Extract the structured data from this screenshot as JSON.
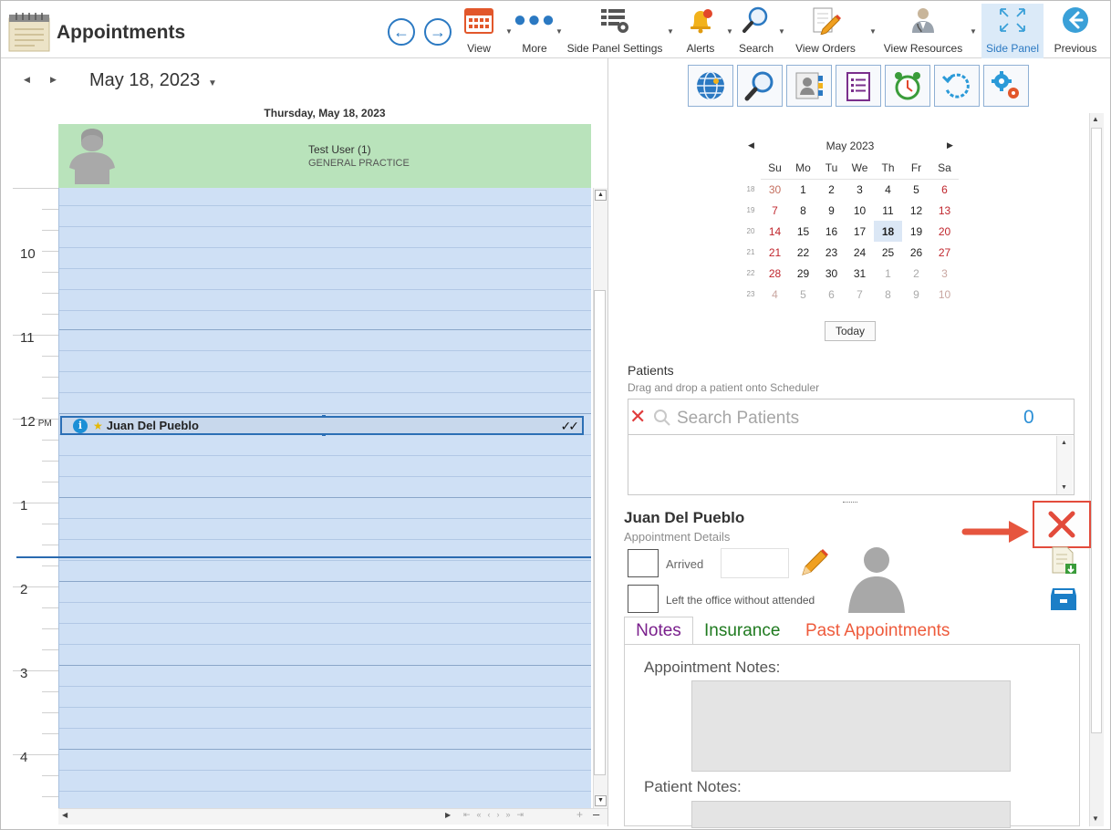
{
  "app": {
    "title": "Appointments"
  },
  "toolbar": {
    "view_label": "View",
    "more_label": "More",
    "side_panel_settings_label": "Side Panel Settings",
    "alerts_label": "Alerts",
    "search_label": "Search",
    "view_orders_label": "View Orders",
    "view_resources_label": "View Resources",
    "side_panel_label": "Side Panel",
    "previous_label": "Previous"
  },
  "scheduler": {
    "date_label": "May 18, 2023",
    "day_header": "Thursday, May 18, 2023",
    "resource_name": "Test User (1)",
    "resource_dept": "GENERAL PRACTICE",
    "hours": [
      {
        "label": "10",
        "suffix": ""
      },
      {
        "label": "11",
        "suffix": ""
      },
      {
        "label": "12",
        "suffix": "PM"
      },
      {
        "label": "1",
        "suffix": ""
      },
      {
        "label": "2",
        "suffix": ""
      },
      {
        "label": "3",
        "suffix": ""
      },
      {
        "label": "4",
        "suffix": ""
      }
    ],
    "appointment": {
      "patient": "Juan Del Pueblo",
      "status_marks": "✓✓"
    }
  },
  "mini_calendar": {
    "month_label": "May 2023",
    "weekdays": [
      "Su",
      "Mo",
      "Tu",
      "We",
      "Th",
      "Fr",
      "Sa"
    ],
    "weeks": [
      {
        "wk": "18",
        "days": [
          "30",
          "1",
          "2",
          "3",
          "4",
          "5",
          "6"
        ]
      },
      {
        "wk": "19",
        "days": [
          "7",
          "8",
          "9",
          "10",
          "11",
          "12",
          "13"
        ]
      },
      {
        "wk": "20",
        "days": [
          "14",
          "15",
          "16",
          "17",
          "18",
          "19",
          "20"
        ]
      },
      {
        "wk": "21",
        "days": [
          "21",
          "22",
          "23",
          "24",
          "25",
          "26",
          "27"
        ]
      },
      {
        "wk": "22",
        "days": [
          "28",
          "29",
          "30",
          "31",
          "1",
          "2",
          "3"
        ]
      },
      {
        "wk": "23",
        "days": [
          "4",
          "5",
          "6",
          "7",
          "8",
          "9",
          "10"
        ]
      }
    ],
    "selected_day": "18",
    "today_label": "Today"
  },
  "patients": {
    "title": "Patients",
    "hint": "Drag and drop a patient onto Scheduler",
    "search_placeholder": "Search Patients",
    "count": "0"
  },
  "appointment_details": {
    "patient_name": "Juan Del Pueblo",
    "subtitle": "Appointment Details",
    "arrived_label": "Arrived",
    "left_office_label": "Left the office without attended"
  },
  "tabs": {
    "notes": "Notes",
    "insurance": "Insurance",
    "past_appointments": "Past Appointments"
  },
  "notes": {
    "appointment_notes_label": "Appointment Notes:",
    "patient_notes_label": "Patient Notes:"
  },
  "colors": {
    "accent": "#2b79c2",
    "resource_header": "#b9e3bb",
    "schedule_bg": "#cfe0f5",
    "delete_red": "#e24b3b"
  }
}
